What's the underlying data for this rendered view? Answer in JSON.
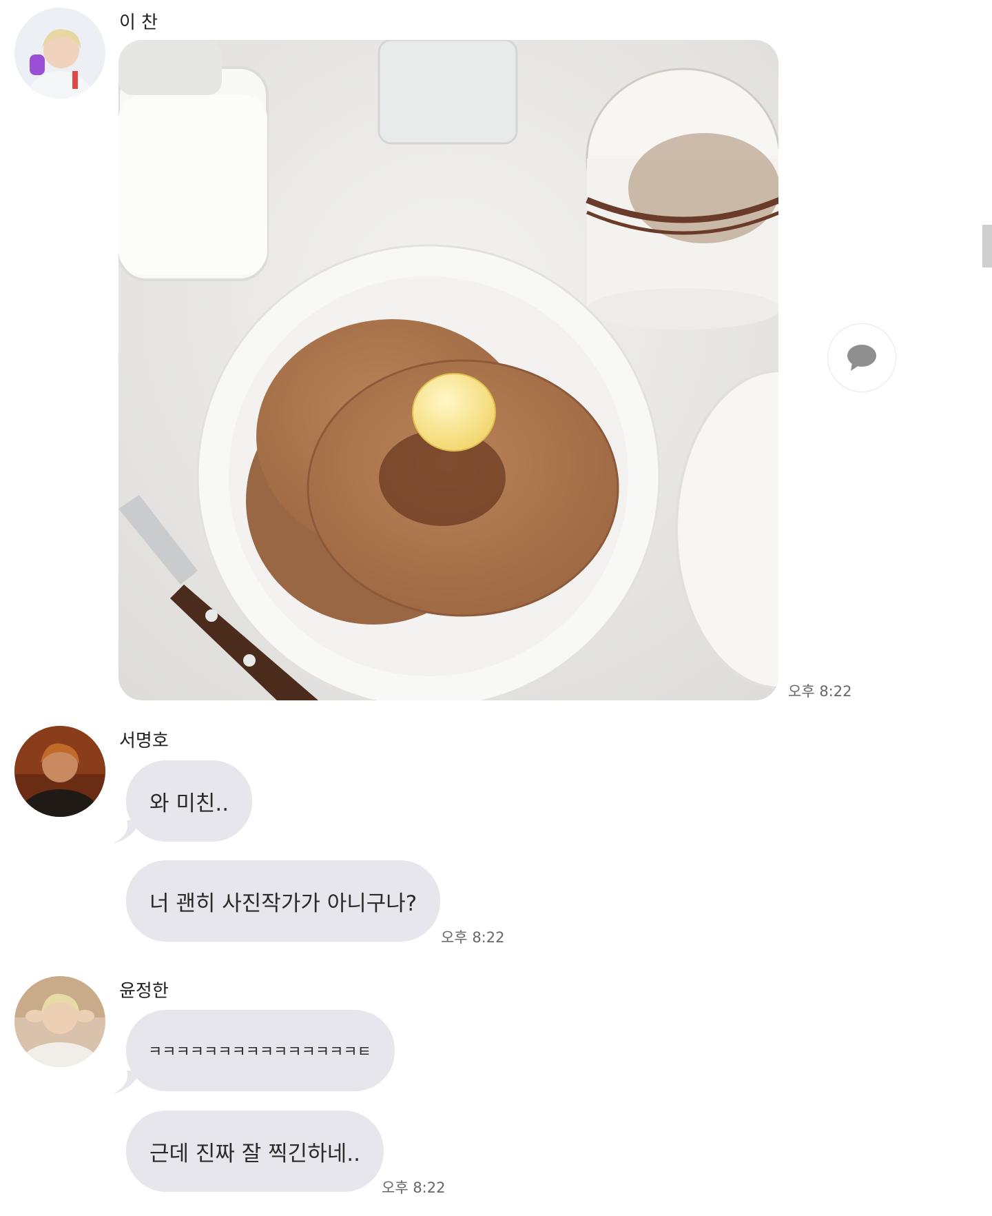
{
  "messages": [
    {
      "sender": "이 찬",
      "avatar": "avatar-lee-chan",
      "image_alt": "pancakes with butter on a white plate, milk bottle, glass and cup",
      "time": "오후 8:22"
    },
    {
      "sender": "서명호",
      "avatar": "avatar-seo-myungho",
      "bubbles": [
        "와 미친..",
        "너 괜히 사진작가가 아니구나?"
      ],
      "time": "오후 8:22"
    },
    {
      "sender": "윤정한",
      "avatar": "avatar-yoon-jeonghan",
      "bubbles": [
        "ㅋㅋㅋㅋㅋㅋㅋㅋㅋㅋㅋㅋㅋㅋㅋㅌ",
        "근데 진짜 잘 찍긴하네.."
      ],
      "time": "오후 8:22"
    }
  ],
  "icons": {
    "comment": "speech-bubble-icon"
  },
  "colors": {
    "bubble": "#e6e6ec",
    "time_text": "#666666"
  }
}
